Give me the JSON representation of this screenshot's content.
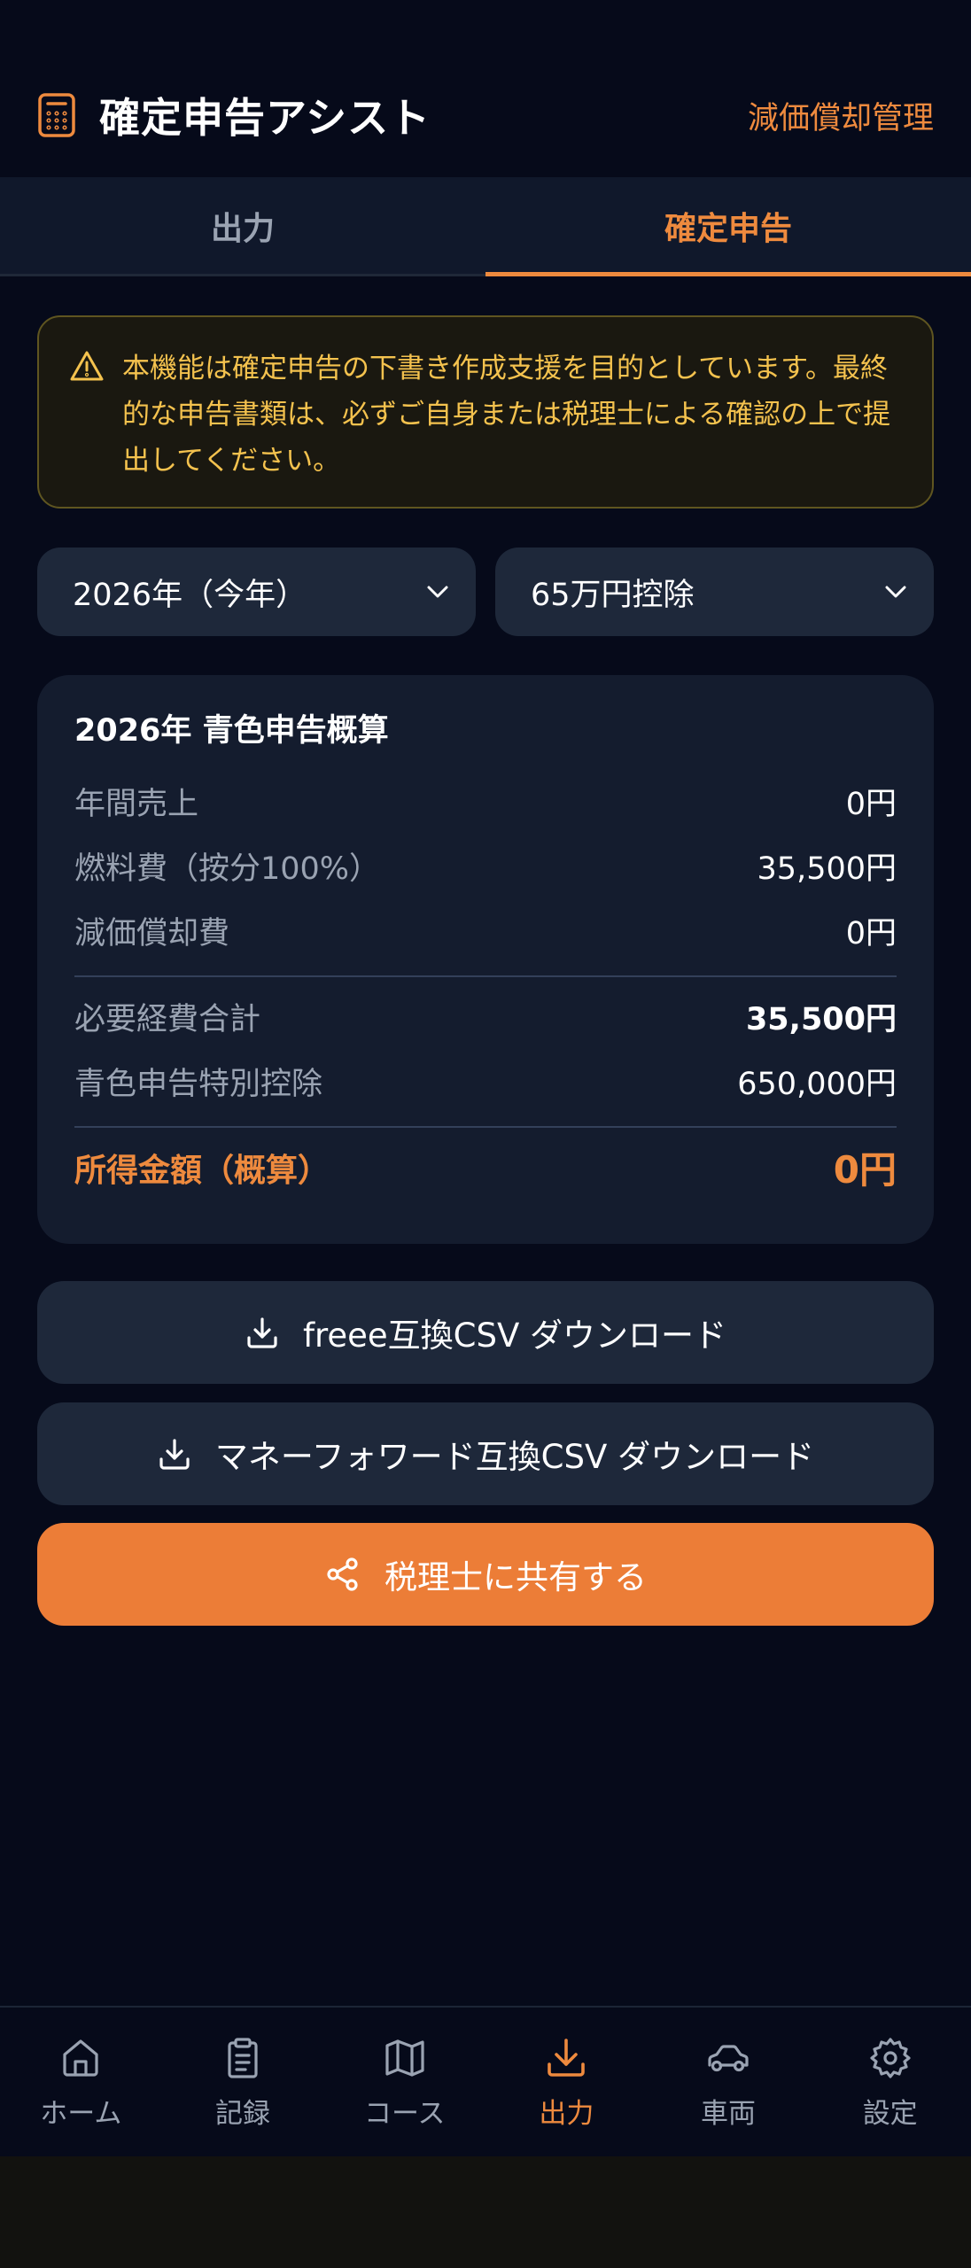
{
  "header": {
    "title": "確定申告アシスト",
    "link_label": "減価償却管理"
  },
  "tabs": [
    {
      "label": "出力",
      "active": false
    },
    {
      "label": "確定申告",
      "active": true
    }
  ],
  "notice": {
    "text": "本機能は確定申告の下書き作成支援を目的としています。最終的な申告書類は、必ずご自身または税理士による確認の上で提出してください。"
  },
  "filters": {
    "year": "2026年（今年）",
    "deduction": "65万円控除"
  },
  "summary": {
    "title": "2026年 青色申告概算",
    "rows": [
      {
        "label": "年間売上",
        "value": "0円"
      },
      {
        "label": "燃料費（按分100%）",
        "value": "35,500円"
      },
      {
        "label": "減価償却費",
        "value": "0円"
      }
    ],
    "rows2": [
      {
        "label": "必要経費合計",
        "value": "35,500円"
      },
      {
        "label": "青色申告特別控除",
        "value": "650,000円"
      }
    ],
    "total": {
      "label": "所得金額（概算）",
      "value": "0円"
    }
  },
  "actions": {
    "freee": "freee互換CSV ダウンロード",
    "mf": "マネーフォワード互換CSV ダウンロード",
    "share": "税理士に共有する"
  },
  "nav": [
    {
      "label": "ホーム",
      "icon": "home-icon"
    },
    {
      "label": "記録",
      "icon": "clipboard-icon"
    },
    {
      "label": "コース",
      "icon": "map-icon"
    },
    {
      "label": "出力",
      "icon": "download-icon",
      "active": true
    },
    {
      "label": "車両",
      "icon": "car-icon"
    },
    {
      "label": "設定",
      "icon": "gear-icon"
    }
  ],
  "colors": {
    "accent": "#ee8a3e",
    "background": "#060a1a",
    "card": "#141c2e",
    "warning": "#f4c24e"
  }
}
